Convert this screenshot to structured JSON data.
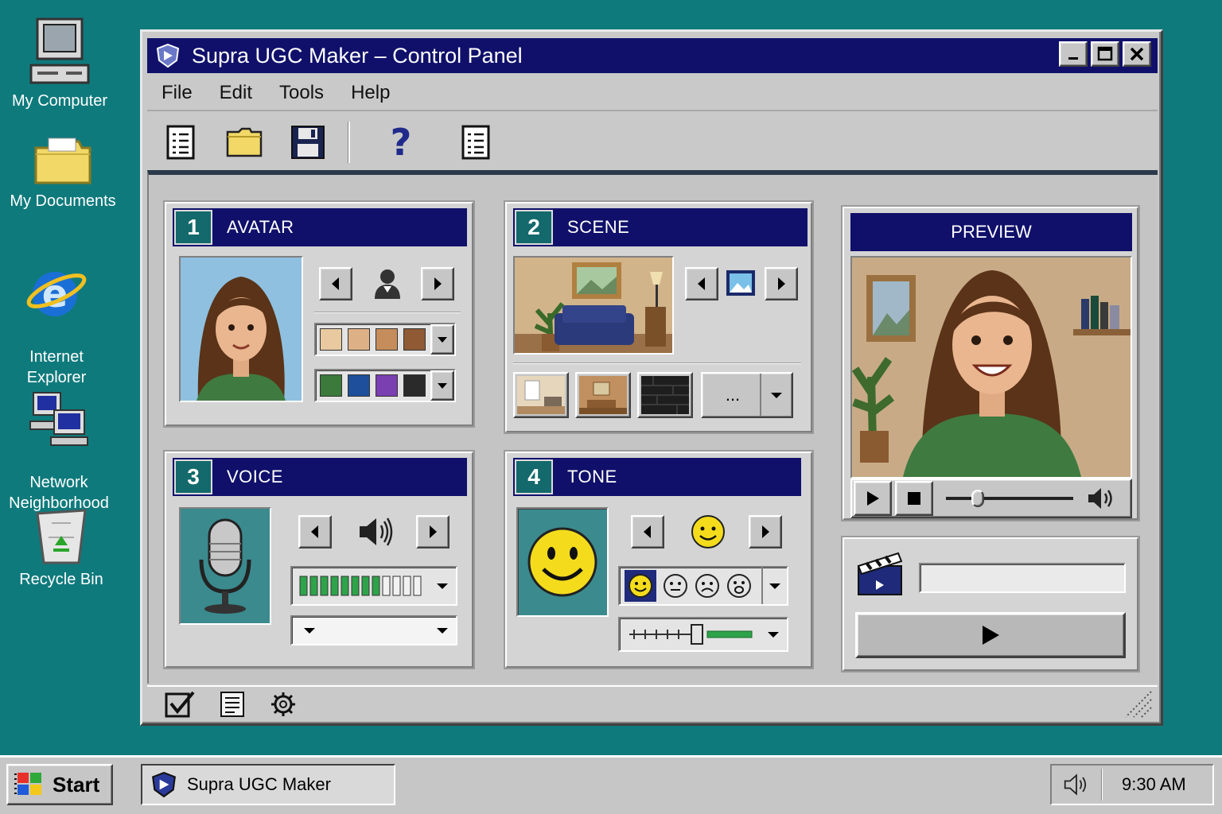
{
  "desktop": {
    "icons": [
      {
        "label": "My Computer"
      },
      {
        "label": "My Documents"
      },
      {
        "label": "Internet\nExplorer"
      },
      {
        "label": "Network\nNeighborhood"
      },
      {
        "label": "Recycle Bin"
      }
    ]
  },
  "window": {
    "title": "Supra UGC Maker – Control Panel",
    "menu": [
      "File",
      "Edit",
      "Tools",
      "Help"
    ],
    "toolbar_icons": [
      "new-document-icon",
      "open-folder-icon",
      "save-disk-icon",
      "help-icon",
      "list-icon"
    ]
  },
  "sections": {
    "avatar": {
      "number": "1",
      "title": "AVATAR",
      "skin_swatches": [
        "#e8c9a0",
        "#deb086",
        "#c58d5c",
        "#8f5a34"
      ],
      "shirt_swatches": [
        "#3b7a3a",
        "#1e4f9a",
        "#7a3fb0",
        "#2a2a2a"
      ]
    },
    "scene": {
      "number": "2",
      "title": "SCENE",
      "more_label": "..."
    },
    "voice": {
      "number": "3",
      "title": "VOICE",
      "level_on": 8,
      "level_total": 12
    },
    "tone": {
      "number": "4",
      "title": "TONE"
    },
    "preview": {
      "title": "PREVIEW"
    }
  },
  "colors": {
    "titlebar": "#10106b",
    "desktop": "#0f7a7c",
    "section_number_bg": "#13696b"
  },
  "taskbar": {
    "start_label": "Start",
    "task_label": "Supra UGC Maker",
    "clock": "9:30 AM"
  }
}
